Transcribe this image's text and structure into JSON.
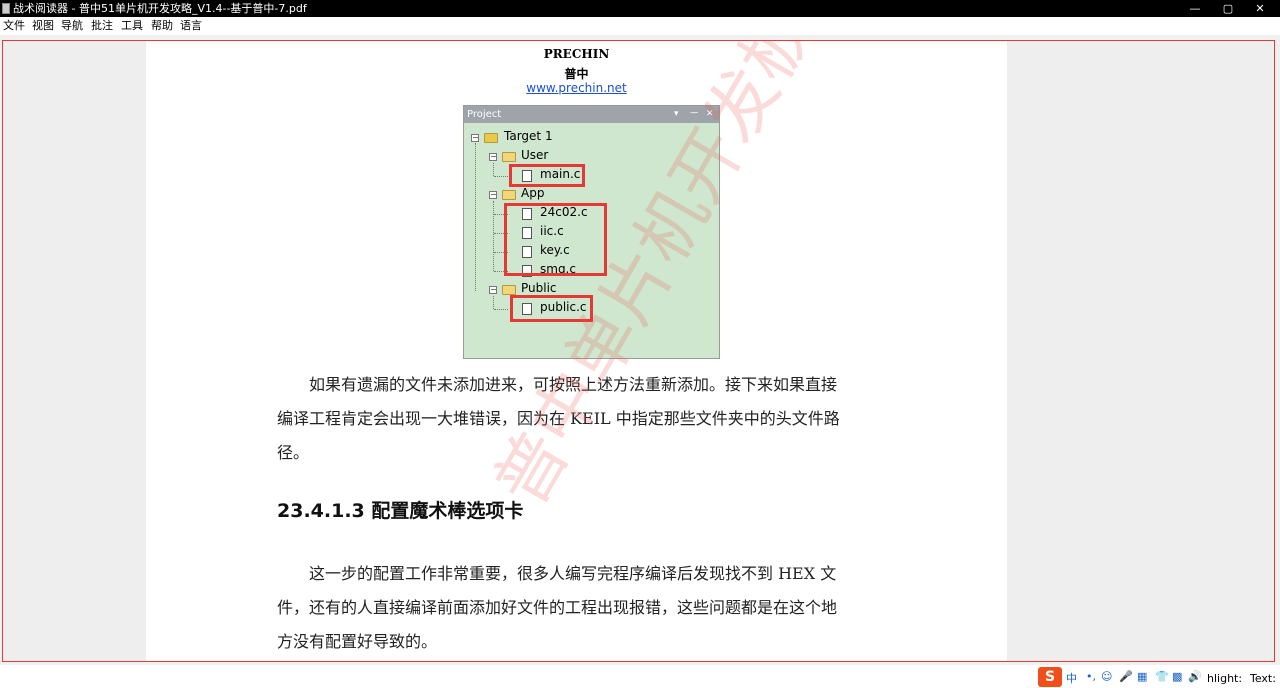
{
  "window": {
    "title": "战术阅读器 - 普中51单片机开发攻略_V1.4--基于普中-7.pdf",
    "min_label": "—",
    "max_label": "▢",
    "close_label": "✕"
  },
  "menu": [
    "文件",
    "视图",
    "导航",
    "批注",
    "工具",
    "帮助",
    "语言"
  ],
  "page": {
    "header_line1": "PRECHIN",
    "header_line2": "普中",
    "header_url": "www.prechin.net",
    "project_panel": {
      "title": "Project",
      "controls": [
        "▾",
        "ᅮ",
        "✕"
      ],
      "target": "Target 1",
      "groups": [
        {
          "name": "User",
          "files": [
            "main.c"
          ]
        },
        {
          "name": "App",
          "files": [
            "24c02.c",
            "iic.c",
            "key.c",
            "smg.c"
          ]
        },
        {
          "name": "Public",
          "files": [
            "public.c"
          ]
        }
      ]
    },
    "paragraph1_lines": [
      "　　如果有遗漏的文件未添加进来，可按照上述方法重新添加。接下来如果直接",
      "编译工程肯定会出现一大堆错误，因为在 KEIL 中指定那些文件夹中的头文件路",
      "径。"
    ],
    "heading": "23.4.1.3  配置魔术棒选项卡",
    "paragraph2_lines": [
      "　　这一步的配置工作非常重要，很多人编写完程序编译后发现找不到 HEX 文",
      "件，还有的人直接编译前面添加好文件的工程出现报错，这些问题都是在这个地",
      "方没有配置好导致的。"
    ],
    "watermark": "普中单片机开发板"
  },
  "taskbar": {
    "ime_logo": "S",
    "ime_icons": [
      "中",
      "•,",
      "☺",
      "🎤",
      "▦",
      "👕",
      "▩",
      "🔊"
    ],
    "tray_text_1": "hlight:",
    "tray_text_2": "Text:"
  },
  "colors": {
    "viewer_border": "#e53935",
    "project_bg": "#cfe7cf",
    "url_color": "#1a4fd0"
  }
}
